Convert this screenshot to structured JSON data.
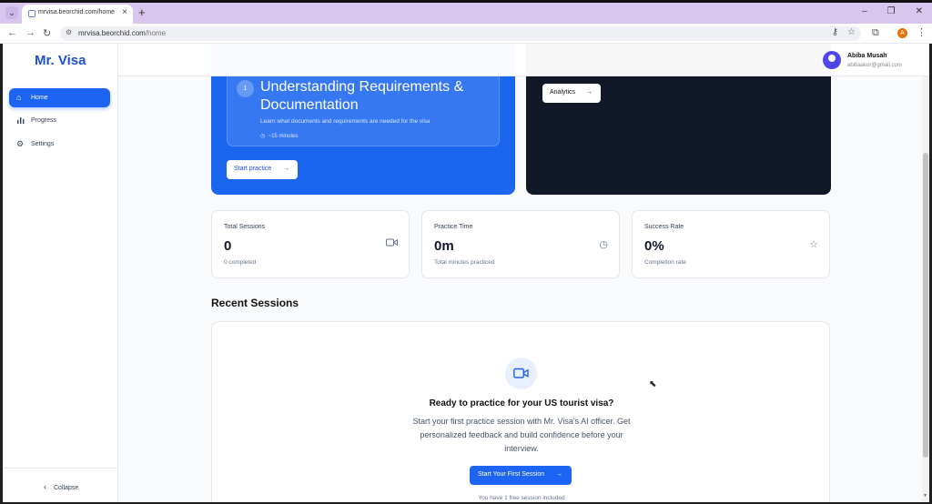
{
  "browser": {
    "tab_title": "mrvisa.beorchid.com/home",
    "url_host": "mrvisa.beorchid.com",
    "url_path": "/home",
    "profile_initial": "A"
  },
  "sidebar": {
    "logo": "Mr. Visa",
    "items": [
      {
        "label": "Home",
        "icon": "home-icon",
        "active": true
      },
      {
        "label": "Progress",
        "icon": "bar-chart-icon",
        "active": false
      },
      {
        "label": "Settings",
        "icon": "gear-icon",
        "active": false
      }
    ],
    "collapse_label": "Collapse"
  },
  "user": {
    "name": "Abiba Musah",
    "email": "abibaakor@gmail.com"
  },
  "hero": {
    "step_number": "1",
    "module_title": "Understanding Requirements & Documentation",
    "module_desc": "Learn what documents and requirements are needed for the visa",
    "module_time": "~15 minutes",
    "start_label": "Start practice",
    "analytics_label": "Analytics"
  },
  "stats": [
    {
      "label": "Total Sessions",
      "value": "0",
      "sub": "0 completed",
      "icon": "video-icon"
    },
    {
      "label": "Practice Time",
      "value": "0m",
      "sub": "Total minutes practiced",
      "icon": "clock-icon"
    },
    {
      "label": "Success Rate",
      "value": "0%",
      "sub": "Completion rate",
      "icon": "star-icon"
    }
  ],
  "recent": {
    "title": "Recent Sessions",
    "empty_title": "Ready to practice for your US tourist visa?",
    "empty_desc": "Start your first practice session with Mr. Visa's AI officer. Get personalized feedback and build confidence before your interview.",
    "cta_label": "Start Your First Session",
    "free_note": "You have 1 free session included"
  },
  "colors": {
    "primary": "#1d64f2",
    "hero_blue": "#1a66ef",
    "hero_dark": "#111827"
  }
}
